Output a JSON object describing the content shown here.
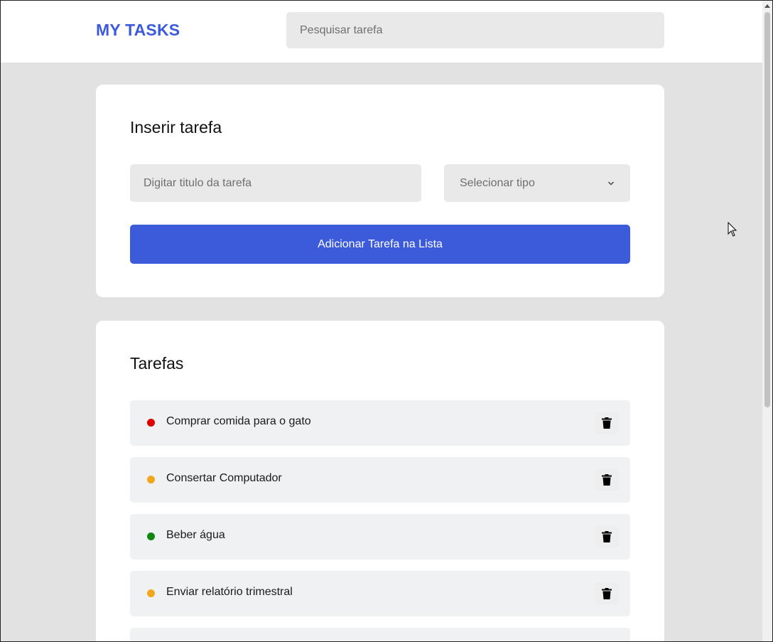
{
  "header": {
    "logo": "MY TASKS",
    "search_placeholder": "Pesquisar tarefa"
  },
  "insert": {
    "title": "Inserir tarefa",
    "title_placeholder": "Digitar titulo da tarefa",
    "type_selected": "Selecionar tipo",
    "add_button": "Adicionar Tarefa na Lista"
  },
  "tasks": {
    "title": "Tarefas",
    "items": [
      {
        "label": "Comprar comida para o gato",
        "color": "#e00000"
      },
      {
        "label": "Consertar Computador",
        "color": "#f2a71b"
      },
      {
        "label": "Beber água",
        "color": "#118611"
      },
      {
        "label": "Enviar relatório trimestral",
        "color": "#f2a71b"
      }
    ]
  },
  "icons": {
    "delete": "trash-icon",
    "select": "chevron-down-icon"
  }
}
